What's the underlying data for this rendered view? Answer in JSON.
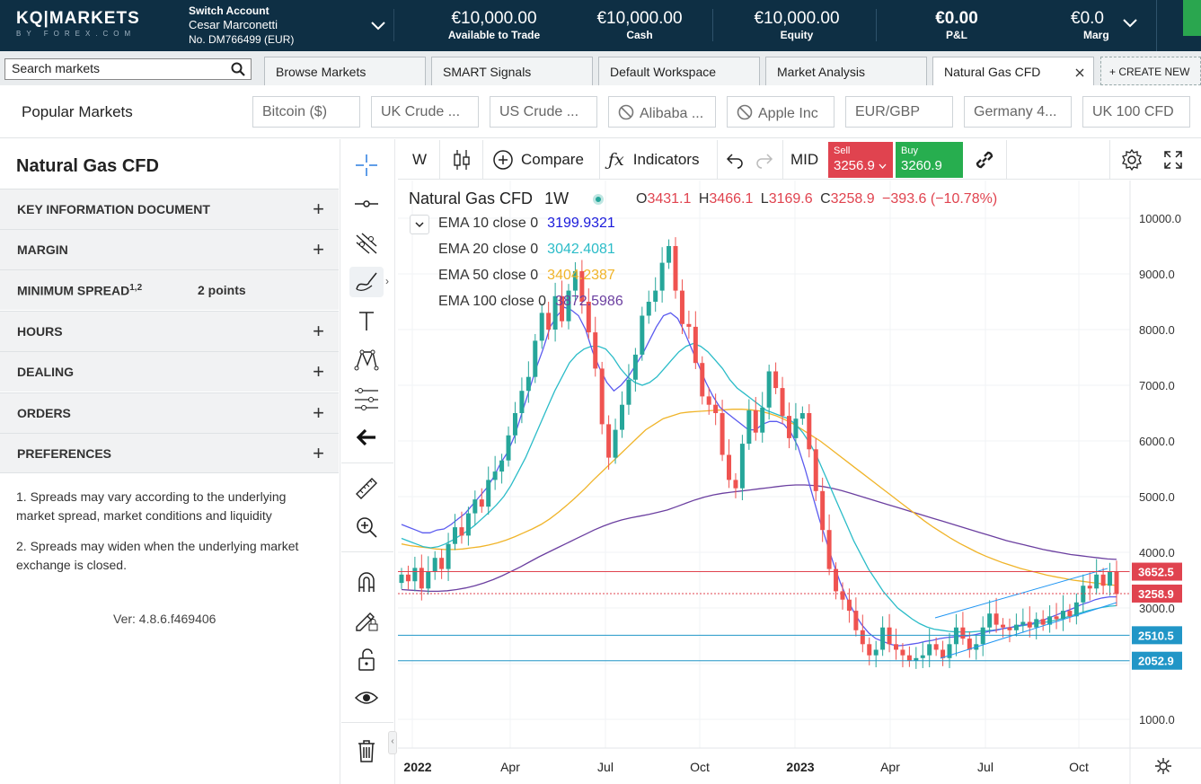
{
  "header": {
    "logo_top": "KQ|MARKETS",
    "logo_bottom": "BY FOREX.COM",
    "switch_account": "Switch Account",
    "account_name": "Cesar Marconetti",
    "account_no": "No. DM766499 (EUR)",
    "stats": [
      {
        "value": "€10,000.00",
        "label": "Available to Trade"
      },
      {
        "value": "€10,000.00",
        "label": "Cash"
      },
      {
        "value": "€10,000.00",
        "label": "Equity"
      },
      {
        "value": "€0.00",
        "label": "P&L"
      },
      {
        "value": "€0.0",
        "label": "Marg"
      }
    ]
  },
  "tabs": {
    "search_placeholder": "Search markets",
    "items": [
      "Browse Markets",
      "SMART Signals",
      "Default Workspace",
      "Market Analysis",
      "Natural Gas CFD"
    ],
    "create_new": "+ CREATE NEW"
  },
  "popular": {
    "title": "Popular Markets",
    "chips": [
      "Bitcoin ($)",
      "UK Crude ...",
      "US Crude ...",
      "Alibaba ...",
      "Apple Inc",
      "EUR/GBP",
      "Germany 4...",
      "UK 100 CFD"
    ]
  },
  "instrument": {
    "title": "Natural Gas CFD",
    "sections": [
      "KEY INFORMATION DOCUMENT",
      "MARGIN",
      "MINIMUM SPREAD",
      "HOURS",
      "DEALING",
      "ORDERS",
      "PREFERENCES"
    ],
    "spread_sup": "1,2",
    "spread_value": "2 points",
    "notes": [
      "1. Spreads may vary according to the underlying market spread, market conditions and liquidity",
      "2. Spreads may widen when the underlying market exchange is closed."
    ],
    "version": "Ver: 4.8.6.f469406"
  },
  "chart_toolbar": {
    "interval": "W",
    "compare": "Compare",
    "indicators": "Indicators",
    "price_mode": "MID",
    "sell_label": "Sell",
    "sell_price": "3256.9",
    "buy_label": "Buy",
    "buy_price": "3260.9"
  },
  "chart_legend": {
    "symbol": "Natural Gas CFD",
    "interval": "1W",
    "o_label": "O",
    "o": "3431.1",
    "h_label": "H",
    "h": "3466.1",
    "l_label": "L",
    "l": "3169.6",
    "c_label": "C",
    "c": "3258.9",
    "change": "−393.6 (−10.78%)",
    "emas": [
      {
        "name": "EMA 10 close 0",
        "value": "3199.9321",
        "color": "#1a1adb"
      },
      {
        "name": "EMA 20 close 0",
        "value": "3042.4081",
        "color": "#2bbcc8"
      },
      {
        "name": "EMA 50 close 0",
        "value": "3404.2387",
        "color": "#f0b429"
      },
      {
        "name": "EMA 100 close 0",
        "value": "3872.5986",
        "color": "#6b3fa0"
      }
    ]
  },
  "chart_data": {
    "type": "candlestick",
    "title": "Natural Gas CFD 1W",
    "y_axis_ticks": [
      1000,
      2000,
      3000,
      4000,
      5000,
      6000,
      7000,
      8000,
      9000,
      10000
    ],
    "y_tick_labels": [
      "1000.0",
      "2000.0",
      "3000.0",
      "4000.0",
      "5000.0",
      "6000.0",
      "7000.0",
      "8000.0",
      "9000.0",
      "10000.0"
    ],
    "x_tick_labels": [
      "2022",
      "Apr",
      "Jul",
      "Oct",
      "2023",
      "Apr",
      "Jul",
      "Oct"
    ],
    "price_labels": [
      {
        "value": 3652.5,
        "text": "3652.5",
        "color": "#e0434f"
      },
      {
        "value": 3258.9,
        "text": "3258.9",
        "color": "#e0434f"
      },
      {
        "value": 2510.5,
        "text": "2510.5",
        "color": "#2196c7"
      },
      {
        "value": 2052.9,
        "text": "2052.9",
        "color": "#2196c7"
      }
    ],
    "close": [
      3600,
      3480,
      3720,
      3350,
      3650,
      3900,
      3700,
      4150,
      4450,
      4300,
      4700,
      4950,
      4820,
      5300,
      5450,
      5650,
      6100,
      6500,
      6900,
      7150,
      7800,
      8300,
      8000,
      8600,
      8150,
      8700,
      9050,
      8500,
      7950,
      7300,
      6300,
      5700,
      6200,
      6650,
      7100,
      7550,
      8250,
      8500,
      8700,
      9200,
      9500,
      8700,
      8100,
      8050,
      7400,
      6800,
      6650,
      6500,
      5750,
      5300,
      5150,
      5950,
      6550,
      6150,
      6600,
      7250,
      6950,
      6450,
      6050,
      6400,
      6500,
      5850,
      5100,
      4400,
      3700,
      3300,
      3150,
      2950,
      2600,
      2350,
      2150,
      2250,
      2650,
      2350,
      2250,
      2150,
      2050,
      2100,
      2150,
      2350,
      2250,
      2100,
      2350,
      2650,
      2450,
      2250,
      2350,
      2650,
      2900,
      2700,
      2650,
      2600,
      2700,
      2750,
      2650,
      2800,
      2700,
      2850,
      2800,
      2950,
      2850,
      3100,
      3400,
      3350,
      3600,
      3400,
      3650,
      3250
    ],
    "ema10": [
      4500,
      4450,
      4400,
      4350,
      4350,
      4400,
      4420,
      4500,
      4600,
      4700,
      4850,
      5000,
      5150,
      5350,
      5600,
      5800,
      6100,
      6500,
      6900,
      7300,
      7650,
      8050,
      8250,
      8400,
      8350,
      8250,
      8000,
      7600,
      7300,
      7050,
      6900,
      7000,
      7150,
      7350,
      7550,
      7800,
      8050,
      8250,
      8300,
      8200,
      7950,
      7650,
      7350,
      7050,
      6800,
      6600,
      6500,
      6400,
      6300,
      6200,
      6200,
      6300,
      6350,
      6350,
      6300,
      6150,
      5900,
      5500,
      5050,
      4600,
      4200,
      3800,
      3450,
      3150,
      2900,
      2700,
      2550,
      2450,
      2400,
      2350,
      2320,
      2330,
      2350,
      2370,
      2400,
      2420,
      2450,
      2470,
      2480,
      2490,
      2500,
      2520,
      2550,
      2580,
      2600,
      2630,
      2650,
      2680,
      2700,
      2720,
      2760,
      2800,
      2850,
      2900,
      2950,
      3000,
      3060,
      3100,
      3150,
      3180,
      3200,
      3199.9321
    ],
    "ema20": [
      4250,
      4200,
      4150,
      4100,
      4080,
      4100,
      4150,
      4220,
      4300,
      4380,
      4480,
      4600,
      4720,
      4850,
      5000,
      5200,
      5450,
      5700,
      6000,
      6300,
      6600,
      6900,
      7150,
      7400,
      7550,
      7650,
      7700,
      7700,
      7650,
      7500,
      7300,
      7150,
      7050,
      7000,
      7050,
      7150,
      7300,
      7450,
      7600,
      7700,
      7750,
      7700,
      7600,
      7450,
      7300,
      7100,
      6950,
      6850,
      6750,
      6650,
      6550,
      6500,
      6450,
      6400,
      6300,
      6150,
      5950,
      5700,
      5400,
      5100,
      4800,
      4500,
      4200,
      3950,
      3700,
      3500,
      3300,
      3150,
      3000,
      2900,
      2800,
      2720,
      2660,
      2620,
      2600,
      2580,
      2570,
      2570,
      2570,
      2580,
      2590,
      2600,
      2620,
      2640,
      2660,
      2680,
      2700,
      2720,
      2740,
      2760,
      2790,
      2830,
      2870,
      2910,
      2950,
      2980,
      3010,
      3030,
      3042.4081
    ],
    "ema50": [
      4150,
      4120,
      4100,
      4080,
      4060,
      4050,
      4050,
      4060,
      4080,
      4100,
      4130,
      4170,
      4220,
      4280,
      4350,
      4420,
      4500,
      4600,
      4720,
      4850,
      4990,
      5140,
      5300,
      5450,
      5600,
      5750,
      5900,
      6050,
      6200,
      6300,
      6400,
      6450,
      6500,
      6520,
      6530,
      6540,
      6550,
      6560,
      6570,
      6570,
      6560,
      6540,
      6500,
      6450,
      6380,
      6300,
      6200,
      6100,
      6000,
      5880,
      5760,
      5640,
      5520,
      5400,
      5280,
      5160,
      5040,
      4920,
      4800,
      4680,
      4560,
      4450,
      4350,
      4250,
      4160,
      4080,
      4000,
      3930,
      3870,
      3810,
      3760,
      3710,
      3670,
      3630,
      3590,
      3560,
      3530,
      3500,
      3480,
      3460,
      3440,
      3420,
      3404.2387
    ],
    "ema100": [
      3330,
      3320,
      3310,
      3300,
      3300,
      3310,
      3330,
      3360,
      3400,
      3450,
      3510,
      3580,
      3660,
      3740,
      3830,
      3920,
      4000,
      4080,
      4160,
      4240,
      4320,
      4400,
      4470,
      4530,
      4580,
      4620,
      4650,
      4680,
      4720,
      4760,
      4820,
      4880,
      4940,
      4990,
      5030,
      5060,
      5080,
      5100,
      5120,
      5140,
      5160,
      5180,
      5200,
      5210,
      5210,
      5200,
      5180,
      5150,
      5110,
      5060,
      5010,
      4960,
      4910,
      4860,
      4810,
      4760,
      4710,
      4660,
      4610,
      4560,
      4510,
      4460,
      4410,
      4360,
      4310,
      4260,
      4210,
      4170,
      4130,
      4090,
      4050,
      4020,
      3990,
      3960,
      3940,
      3920,
      3900,
      3880,
      3872.5986
    ],
    "ylim": [
      700,
      10700
    ],
    "grid": true
  },
  "icons": [
    "crosshair-icon",
    "line-tool-icon",
    "fib-icon",
    "brush-icon",
    "text-icon",
    "pattern-icon",
    "measure-icon",
    "back-arrow-icon",
    "ruler-icon",
    "zoom-icon",
    "magnet-icon",
    "lock-pencil-icon",
    "lock-icon",
    "eye-icon",
    "trash-icon"
  ],
  "colors": {
    "up": "#26a69a",
    "down": "#ef5350",
    "header_bg": "#0e2f44",
    "sell": "#e0434f",
    "buy": "#27ae4f"
  }
}
